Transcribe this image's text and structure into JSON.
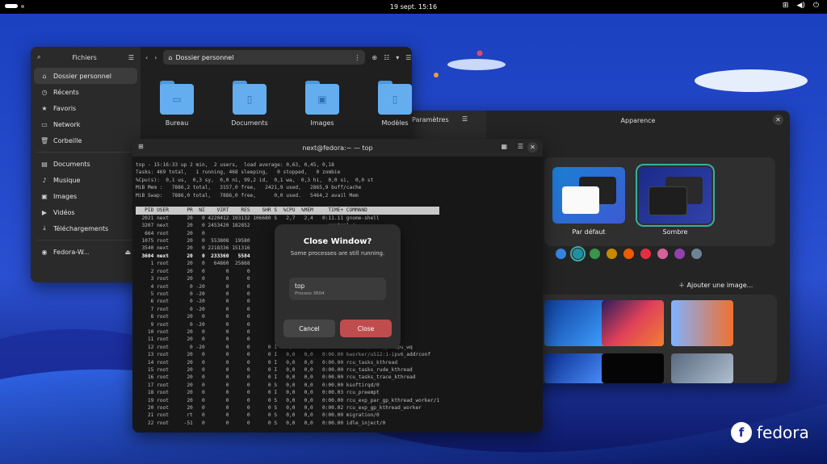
{
  "topbar": {
    "clock": "19 sept.  15:16",
    "tray_icons": [
      "network-icon",
      "volume-icon",
      "power-icon"
    ]
  },
  "files": {
    "sidebar_title": "Fichiers",
    "path": "Dossier personnel",
    "sidebar_items": [
      {
        "label": "Dossier personnel",
        "icon": "home-icon"
      },
      {
        "label": "Récents",
        "icon": "clock-icon"
      },
      {
        "label": "Favoris",
        "icon": "star-icon"
      },
      {
        "label": "Network",
        "icon": "network-icon"
      },
      {
        "label": "Corbeille",
        "icon": "trash-icon"
      }
    ],
    "sidebar_items2": [
      {
        "label": "Documents",
        "icon": "document-icon"
      },
      {
        "label": "Musique",
        "icon": "music-icon"
      },
      {
        "label": "Images",
        "icon": "image-icon"
      },
      {
        "label": "Vidéos",
        "icon": "video-icon"
      },
      {
        "label": "Téléchargements",
        "icon": "download-icon"
      }
    ],
    "drive": "Fedora-W...",
    "folders": [
      "Bureau",
      "Documents",
      "Images",
      "Modèles"
    ]
  },
  "settings": {
    "left_title": "Paramètres",
    "title": "Apparence",
    "theme_default": "Par défaut",
    "theme_dark": "Sombre",
    "add_image": "Ajouter une image...",
    "accent_colors": [
      "#3584e4",
      "#2190a4",
      "#3a944a",
      "#c88800",
      "#ed5b00",
      "#e62d42",
      "#d56199",
      "#9141ac",
      "#6f8396"
    ]
  },
  "terminal": {
    "title": "next@fedora:~ — top",
    "lines": [
      "top - 15:16:33 up 2 min,  2 users,  load average: 0,63, 0,45, 0,18",
      "Tasks: 469 total,   1 running, 468 sleeping,   0 stopped,   0 zombie",
      "%Cpu(s):  0,1 us,  0,3 sy,  0,0 ni, 99,2 id,  0,1 wa,  0,3 hi,  0,0 si,  0,0 st",
      "MiB Mem :   7886,2 total,   3157,0 free,   2421,9 used,   2865,9 buff/cache",
      "MiB Swap:   7886,0 total,   7886,0 free,      0,0 used.   5464,2 avail Mem",
      ""
    ],
    "header": "   PID USER      PR  NI    VIRT    RES    SHR S  %CPU  %MEM     TIME+ COMMAND          ",
    "rows": [
      "  2021 next      20   0 4220412 193132 106680 S   2,7   2,4   0:11.11 gnome-shell",
      "  3207 next      20   0 2453420 182852                          control-c",
      "   664 root      20   0                                          /u513:3-events_unbound",
      "  1075 root      20   0  553808  19580                           Manager",
      "  3540 next      20   0 2218336 151316",
      "  3604 next      20   0  233360   5584",
      "     1 root      20   0   64860  25868",
      "     2 root      20   0       0      0                           d",
      "     3 root      20   0       0      0                           orkqueue_release",
      "     4 root       0 -20       0      0                           /R-rcu_gp",
      "     5 root       0 -20       0      0                           /R-sync_wq",
      "     6 root       0 -20       0      0                           /R-slub_flushwq",
      "     7 root       0 -20       0      0                           /R-netns",
      "     8 root      20   0       0      0                           /0:0-events",
      "     9 root       0 -20       0      0                           /0:0H-events_highpri",
      "    10 root      20   0       0      0                           /0:1-cgroup_destroy",
      "    11 root      20   0       0      0                           /u512:0-events_unbound",
      "    12 root       0 -20       0      0      0 I   0,0   0,0   0:00.00 kworker/R-mm_percpu_wq",
      "    13 root      20   0       0      0      0 I   0,0   0,0   0:00.00 kworker/u512:1-ipv6_addrconf",
      "    14 root      20   0       0      0      0 I   0,0   0,0   0:00.00 rcu_tasks_kthread",
      "    15 root      20   0       0      0      0 I   0,0   0,0   0:00.00 rcu_tasks_rude_kthread",
      "    16 root      20   0       0      0      0 I   0,0   0,0   0:00.00 rcu_tasks_trace_kthread",
      "    17 root      20   0       0      0      0 S   0,0   0,0   0:00.00 ksoftirqd/0",
      "    18 root      20   0       0      0      0 I   0,0   0,0   0:00.03 rcu_preempt",
      "    19 root      20   0       0      0      0 S   0,0   0,0   0:00.00 rcu_exp_par_gp_kthread_worker/1",
      "    20 root      20   0       0      0      0 S   0,0   0,0   0:00.02 rcu_exp_gp_kthread_worker",
      "    21 root      rt   0       0      0      0 S   0,0   0,0   0:00.00 migration/0",
      "    22 root     -51   0       0      0      0 S   0,0   0,0   0:00.00 idle_inject/0"
    ]
  },
  "dialog": {
    "title": "Close Window?",
    "subtitle": "Some processes are still running.",
    "process_name": "top",
    "process_detail": "Process 3604",
    "cancel": "Cancel",
    "close": "Close"
  },
  "brand": {
    "logo_text": "fedora"
  }
}
